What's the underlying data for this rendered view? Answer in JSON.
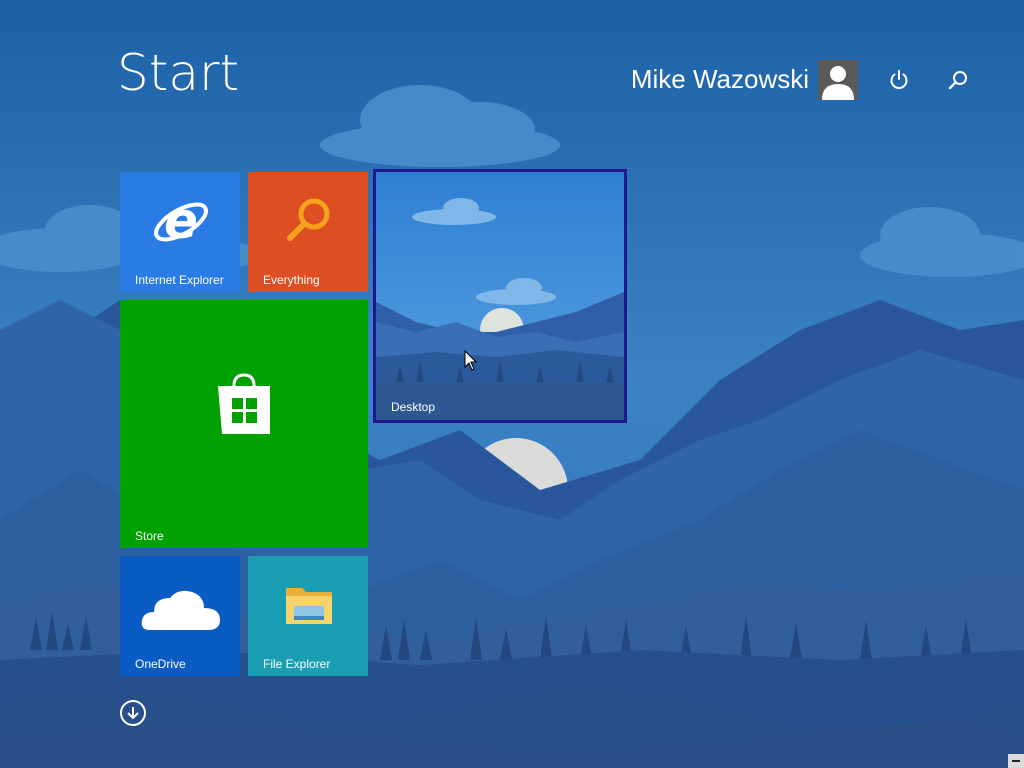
{
  "screen": {
    "title": "Start",
    "user_name": "Mike Wazowski"
  },
  "header_icons": [
    {
      "name": "user-avatar-icon"
    },
    {
      "name": "power-icon"
    },
    {
      "name": "search-icon"
    }
  ],
  "tiles": {
    "internet_explorer": "Internet Explorer",
    "everything": "Everything",
    "desktop": "Desktop",
    "store": "Store",
    "onedrive": "OneDrive",
    "file_explorer": "File Explorer"
  },
  "colors": {
    "internet_explorer": "#2a7be4",
    "everything": "#dd4f22",
    "store": "#00a100",
    "onedrive": "#0b5bc4",
    "file_explorer": "#1a9eb4",
    "desktop_selection_border": "#1e1a8e"
  },
  "all_apps_icon": "arrow-down-circle-icon"
}
